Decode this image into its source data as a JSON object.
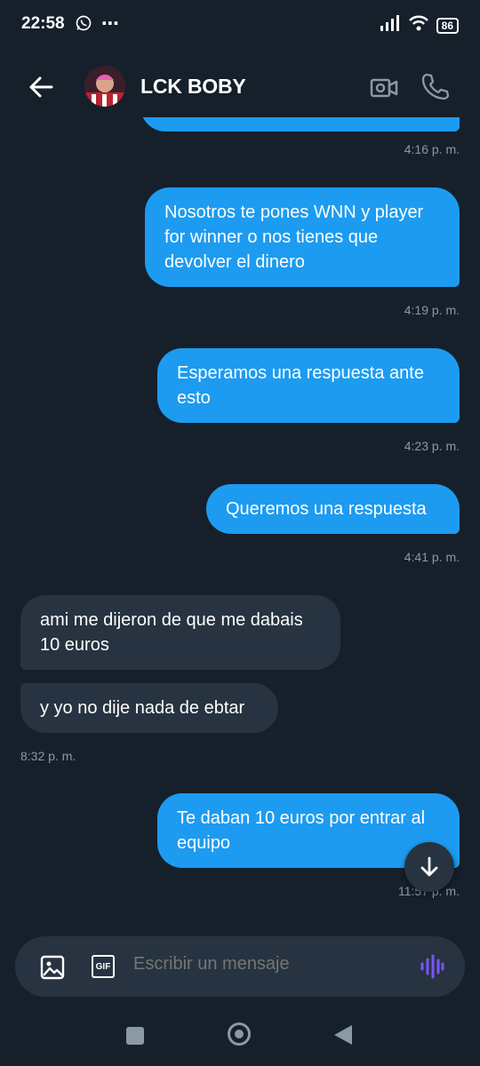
{
  "status_bar": {
    "time": "22:58",
    "battery": "86"
  },
  "header": {
    "contact_name": "LCK BOBY"
  },
  "messages": [
    {
      "direction": "out",
      "text": "",
      "timestamp": "4:16 p. m."
    },
    {
      "direction": "out",
      "text": "Nosotros te pones WNN y player for winner o nos tienes que devolver el dinero",
      "timestamp": "4:19 p. m."
    },
    {
      "direction": "out",
      "text": "Esperamos una respuesta ante esto",
      "timestamp": "4:23 p. m."
    },
    {
      "direction": "out",
      "text": "Queremos una respuesta",
      "timestamp": "4:41 p. m."
    },
    {
      "direction": "in",
      "text": "ami me dijeron de que me dabais 10 euros",
      "timestamp": ""
    },
    {
      "direction": "in",
      "text": "y yo no dije nada de ebtar",
      "timestamp": "8:32 p. m."
    },
    {
      "direction": "out",
      "text": "Te daban 10 euros por entrar al equipo",
      "timestamp": "11:57 p. m."
    }
  ],
  "composer": {
    "placeholder": "Escribir un mensaje",
    "gif_label": "GIF"
  },
  "colors": {
    "background": "#15202b",
    "outgoing_bubble": "#1d9bf0",
    "incoming_bubble": "#273340",
    "voice_accent": "#7856ff"
  },
  "icons": [
    "back-arrow-icon",
    "video-camera-icon",
    "phone-icon",
    "image-icon",
    "gif-icon",
    "voice-wave-icon",
    "arrow-down-icon",
    "whatsapp-icon",
    "signal-icon",
    "wifi-icon"
  ]
}
